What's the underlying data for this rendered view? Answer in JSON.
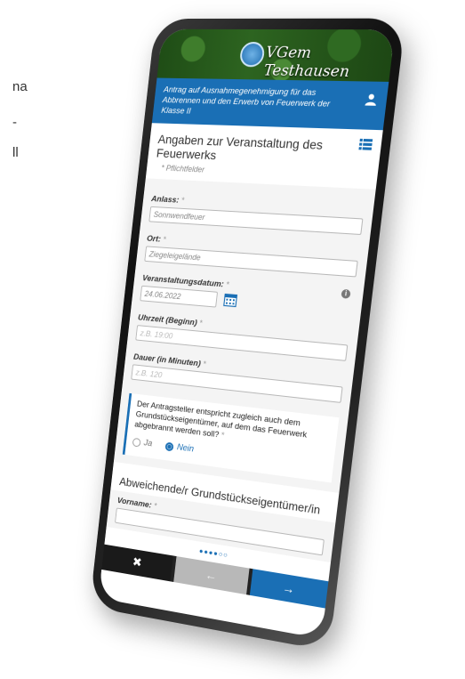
{
  "side_text": [
    "na",
    "-",
    "ll"
  ],
  "brand": "VGem Testhausen",
  "header": {
    "title": "Antrag auf Ausnahmegenehmigung für das Abbrennen und den Erwerb von Feuerwerk der Klasse II"
  },
  "section": {
    "title": "Angaben zur Veranstaltung des Feuerwerks",
    "required_note": "* Pflichtfelder"
  },
  "fields": {
    "anlass": {
      "label": "Anlass:",
      "req": "*",
      "value": "Sonnwendfeuer"
    },
    "ort": {
      "label": "Ort:",
      "req": "*",
      "value": "Ziegeleigelände"
    },
    "datum": {
      "label": "Veranstaltungsdatum:",
      "req": "*",
      "value": "24.06.2022"
    },
    "uhrzeit": {
      "label": "Uhrzeit (Beginn)",
      "req": "*",
      "placeholder": "z.B. 19:00"
    },
    "dauer": {
      "label": "Dauer (in Minuten)",
      "req": "*",
      "placeholder": "z.B. 120"
    }
  },
  "question": {
    "text": "Der Antragsteller entspricht zugleich auch dem Grundstückseigentümer, auf dem das Feuerwerk abgebrannt werden soll?",
    "req": "*",
    "options": [
      "Ja",
      "Nein"
    ],
    "selected": "Nein"
  },
  "subsection": {
    "title": "Abweichende/r Grundstückseigentümer/in",
    "vorname_label": "Vorname:",
    "vorname_req": "*"
  },
  "pager": "●●●●○○",
  "nav": {
    "close": "✖",
    "back": "←",
    "next": "→"
  },
  "colors": {
    "primary": "#1a6fb5",
    "banner": "#2d6420"
  }
}
